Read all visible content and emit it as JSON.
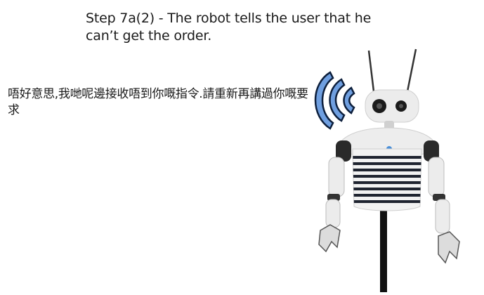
{
  "step": {
    "title": "Step 7a(2) - The robot tells the user that he can’t get the order."
  },
  "robot_speech": {
    "text": "唔好意思,我哋呢邊接收唔到你嘅指令.請重新再講過你嘅要求"
  },
  "colors": {
    "wave_fill": "#6f9fe0",
    "wave_stroke": "#0d1f3c",
    "robot_body": "#e8e8e8",
    "robot_stripe": "#1f2430"
  },
  "icons": {
    "sound": "sound-waves-icon",
    "robot": "humanoid-robot-illustration"
  }
}
